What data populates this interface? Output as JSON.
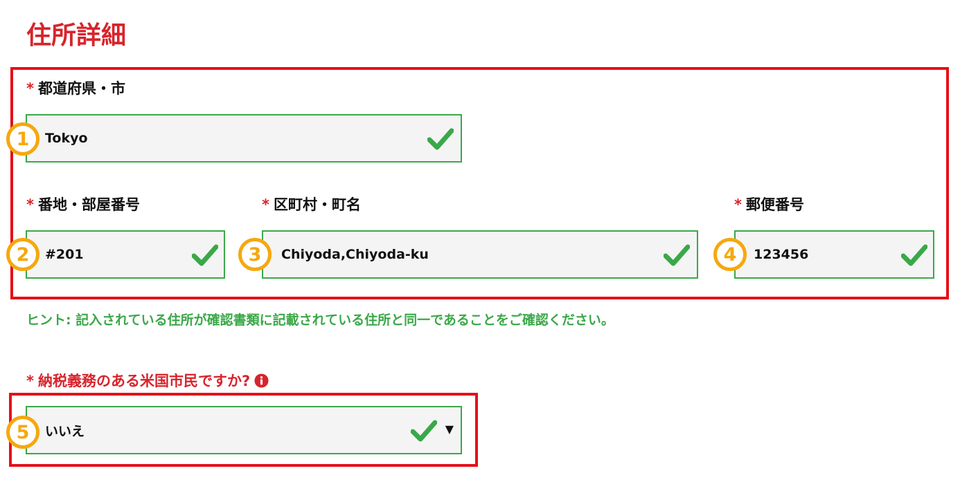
{
  "section_title": "住所詳細",
  "required_mark": "*",
  "fields": {
    "prefecture_city": {
      "label": "都道府県・市",
      "value": "Tokyo",
      "badge": "1"
    },
    "street_room": {
      "label": "番地・部屋番号",
      "value": "#201",
      "badge": "2"
    },
    "ward_town": {
      "label": "区町村・町名",
      "value": "Chiyoda,Chiyoda-ku",
      "badge": "3"
    },
    "postal_code": {
      "label": "郵便番号",
      "value": "123456",
      "badge": "4"
    }
  },
  "hint": "ヒント: 記入されている住所が確認書類に記載されている住所と同一であることをご確認ください。",
  "us_taxpayer": {
    "label": "納税義務のある米国市民ですか?",
    "selected": "いいえ",
    "badge": "5",
    "info_icon": "info-circle-icon"
  },
  "colors": {
    "accent_red": "#d8242c",
    "frame_red": "#e5101a",
    "valid_green": "#3aa848",
    "badge_orange": "#f5a80f",
    "field_bg": "#f4f4f4"
  },
  "icons": {
    "valid": "checkmark-icon",
    "dropdown": "caret-down-icon"
  }
}
